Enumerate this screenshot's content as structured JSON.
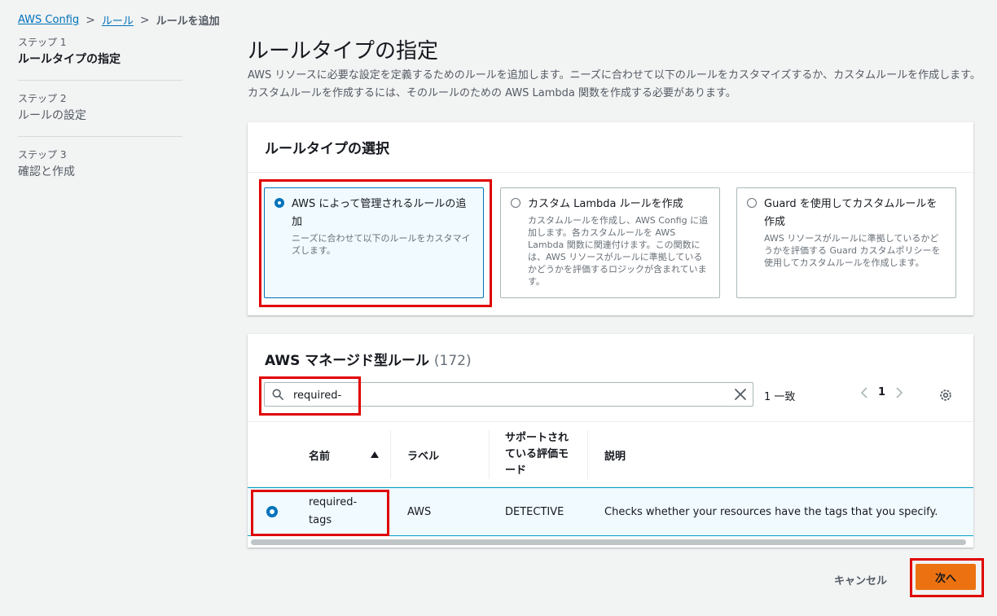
{
  "breadcrumb": {
    "item1": "AWS Config",
    "item2": "ルール",
    "current": "ルールを追加"
  },
  "steps": [
    {
      "num": "ステップ 1",
      "name": "ルールタイプの指定"
    },
    {
      "num": "ステップ 2",
      "name": "ルールの設定"
    },
    {
      "num": "ステップ 3",
      "name": "確認と作成"
    }
  ],
  "page": {
    "title": "ルールタイプの指定",
    "description": "AWS リソースに必要な設定を定義するためのルールを追加します。ニーズに合わせて以下のルールをカスタマイズするか、カスタムルールを作成します。カスタムルールを作成するには、そのルールのための AWS Lambda 関数を作成する必要があります。"
  },
  "rule_type": {
    "title": "ルールタイプの選択",
    "options": [
      {
        "title": "AWS によって管理されるルールの追加",
        "desc": "ニーズに合わせて以下のルールをカスタマイズします。",
        "selected": true
      },
      {
        "title": "カスタム Lambda ルールを作成",
        "desc": "カスタムルールを作成し、AWS Config に追加します。各カスタムルールを AWS Lambda 関数に関連付けます。この関数には、AWS リソースがルールに準拠しているかどうかを評価するロジックが含まれています。",
        "selected": false
      },
      {
        "title": "Guard を使用してカスタムルールを作成",
        "desc": "AWS リソースがルールに準拠しているかどうかを評価する Guard カスタムポリシーを使用してカスタムルールを作成します。",
        "selected": false
      }
    ]
  },
  "managed_rules": {
    "title": "AWS マネージド型ルール",
    "count": "(172)",
    "search_value": "required-",
    "match_text": "1 一致",
    "page_number": "1",
    "columns": {
      "name": "名前",
      "label": "ラベル",
      "mode": "サポートされている評価モード",
      "description": "説明"
    },
    "rows": [
      {
        "name": "required-tags",
        "label": "AWS",
        "mode": "DETECTIVE",
        "description": "Checks whether your resources have the tags that you specify.",
        "selected": true
      }
    ]
  },
  "footer": {
    "cancel": "キャンセル",
    "next": "次へ"
  },
  "colors": {
    "link": "#0073bb",
    "primary_button": "#ec7211",
    "highlight": "#e00000",
    "selected_bg": "#f1faff"
  },
  "icons": [
    "chevron-right-icon",
    "search-icon",
    "clear-icon",
    "chevron-left-icon",
    "gear-icon",
    "sort-up-icon"
  ]
}
